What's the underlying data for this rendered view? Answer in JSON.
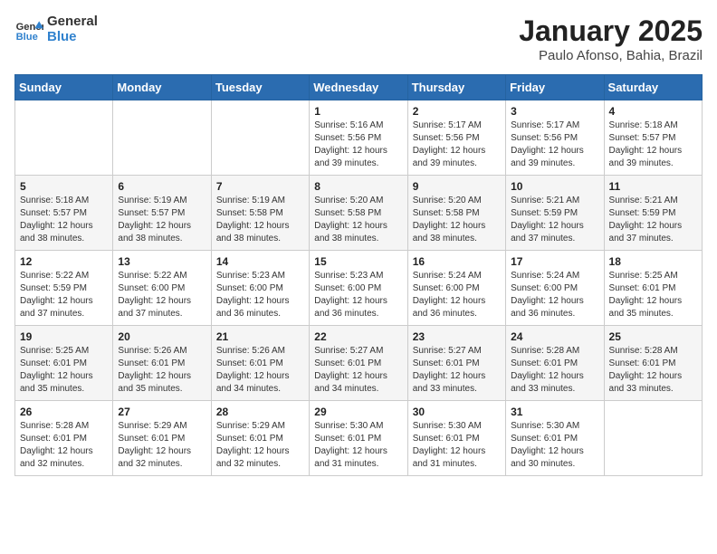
{
  "header": {
    "logo_general": "General",
    "logo_blue": "Blue",
    "title": "January 2025",
    "subtitle": "Paulo Afonso, Bahia, Brazil"
  },
  "days_of_week": [
    "Sunday",
    "Monday",
    "Tuesday",
    "Wednesday",
    "Thursday",
    "Friday",
    "Saturday"
  ],
  "weeks": [
    [
      {
        "day": "",
        "info": ""
      },
      {
        "day": "",
        "info": ""
      },
      {
        "day": "",
        "info": ""
      },
      {
        "day": "1",
        "info": "Sunrise: 5:16 AM\nSunset: 5:56 PM\nDaylight: 12 hours and 39 minutes."
      },
      {
        "day": "2",
        "info": "Sunrise: 5:17 AM\nSunset: 5:56 PM\nDaylight: 12 hours and 39 minutes."
      },
      {
        "day": "3",
        "info": "Sunrise: 5:17 AM\nSunset: 5:56 PM\nDaylight: 12 hours and 39 minutes."
      },
      {
        "day": "4",
        "info": "Sunrise: 5:18 AM\nSunset: 5:57 PM\nDaylight: 12 hours and 39 minutes."
      }
    ],
    [
      {
        "day": "5",
        "info": "Sunrise: 5:18 AM\nSunset: 5:57 PM\nDaylight: 12 hours and 38 minutes."
      },
      {
        "day": "6",
        "info": "Sunrise: 5:19 AM\nSunset: 5:57 PM\nDaylight: 12 hours and 38 minutes."
      },
      {
        "day": "7",
        "info": "Sunrise: 5:19 AM\nSunset: 5:58 PM\nDaylight: 12 hours and 38 minutes."
      },
      {
        "day": "8",
        "info": "Sunrise: 5:20 AM\nSunset: 5:58 PM\nDaylight: 12 hours and 38 minutes."
      },
      {
        "day": "9",
        "info": "Sunrise: 5:20 AM\nSunset: 5:58 PM\nDaylight: 12 hours and 38 minutes."
      },
      {
        "day": "10",
        "info": "Sunrise: 5:21 AM\nSunset: 5:59 PM\nDaylight: 12 hours and 37 minutes."
      },
      {
        "day": "11",
        "info": "Sunrise: 5:21 AM\nSunset: 5:59 PM\nDaylight: 12 hours and 37 minutes."
      }
    ],
    [
      {
        "day": "12",
        "info": "Sunrise: 5:22 AM\nSunset: 5:59 PM\nDaylight: 12 hours and 37 minutes."
      },
      {
        "day": "13",
        "info": "Sunrise: 5:22 AM\nSunset: 6:00 PM\nDaylight: 12 hours and 37 minutes."
      },
      {
        "day": "14",
        "info": "Sunrise: 5:23 AM\nSunset: 6:00 PM\nDaylight: 12 hours and 36 minutes."
      },
      {
        "day": "15",
        "info": "Sunrise: 5:23 AM\nSunset: 6:00 PM\nDaylight: 12 hours and 36 minutes."
      },
      {
        "day": "16",
        "info": "Sunrise: 5:24 AM\nSunset: 6:00 PM\nDaylight: 12 hours and 36 minutes."
      },
      {
        "day": "17",
        "info": "Sunrise: 5:24 AM\nSunset: 6:00 PM\nDaylight: 12 hours and 36 minutes."
      },
      {
        "day": "18",
        "info": "Sunrise: 5:25 AM\nSunset: 6:01 PM\nDaylight: 12 hours and 35 minutes."
      }
    ],
    [
      {
        "day": "19",
        "info": "Sunrise: 5:25 AM\nSunset: 6:01 PM\nDaylight: 12 hours and 35 minutes."
      },
      {
        "day": "20",
        "info": "Sunrise: 5:26 AM\nSunset: 6:01 PM\nDaylight: 12 hours and 35 minutes."
      },
      {
        "day": "21",
        "info": "Sunrise: 5:26 AM\nSunset: 6:01 PM\nDaylight: 12 hours and 34 minutes."
      },
      {
        "day": "22",
        "info": "Sunrise: 5:27 AM\nSunset: 6:01 PM\nDaylight: 12 hours and 34 minutes."
      },
      {
        "day": "23",
        "info": "Sunrise: 5:27 AM\nSunset: 6:01 PM\nDaylight: 12 hours and 33 minutes."
      },
      {
        "day": "24",
        "info": "Sunrise: 5:28 AM\nSunset: 6:01 PM\nDaylight: 12 hours and 33 minutes."
      },
      {
        "day": "25",
        "info": "Sunrise: 5:28 AM\nSunset: 6:01 PM\nDaylight: 12 hours and 33 minutes."
      }
    ],
    [
      {
        "day": "26",
        "info": "Sunrise: 5:28 AM\nSunset: 6:01 PM\nDaylight: 12 hours and 32 minutes."
      },
      {
        "day": "27",
        "info": "Sunrise: 5:29 AM\nSunset: 6:01 PM\nDaylight: 12 hours and 32 minutes."
      },
      {
        "day": "28",
        "info": "Sunrise: 5:29 AM\nSunset: 6:01 PM\nDaylight: 12 hours and 32 minutes."
      },
      {
        "day": "29",
        "info": "Sunrise: 5:30 AM\nSunset: 6:01 PM\nDaylight: 12 hours and 31 minutes."
      },
      {
        "day": "30",
        "info": "Sunrise: 5:30 AM\nSunset: 6:01 PM\nDaylight: 12 hours and 31 minutes."
      },
      {
        "day": "31",
        "info": "Sunrise: 5:30 AM\nSunset: 6:01 PM\nDaylight: 12 hours and 30 minutes."
      },
      {
        "day": "",
        "info": ""
      }
    ]
  ]
}
